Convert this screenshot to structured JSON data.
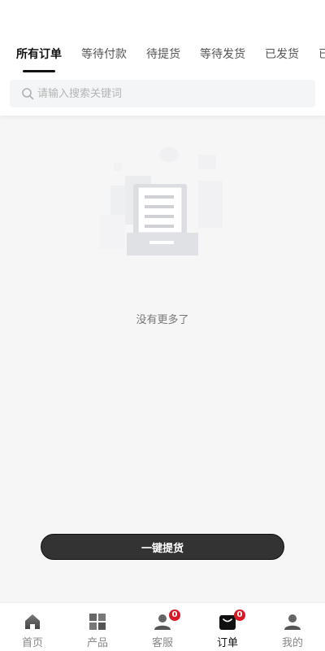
{
  "tabs": [
    {
      "label": "所有订单",
      "active": true
    },
    {
      "label": "等待付款",
      "active": false
    },
    {
      "label": "待提货",
      "active": false
    },
    {
      "label": "等待发货",
      "active": false
    },
    {
      "label": "已发货",
      "active": false
    },
    {
      "label": "已",
      "active": false
    }
  ],
  "search": {
    "placeholder": "请输入搜索关键词",
    "value": ""
  },
  "empty_state": {
    "text": "没有更多了"
  },
  "action_button": {
    "label": "一键提货"
  },
  "bottom_nav": [
    {
      "label": "首页",
      "icon": "home-icon",
      "badge": null
    },
    {
      "label": "产品",
      "icon": "grid-icon",
      "badge": null
    },
    {
      "label": "客服",
      "icon": "customer-service-icon",
      "badge": "0"
    },
    {
      "label": "订单",
      "icon": "order-bag-icon",
      "badge": "0",
      "active": true
    },
    {
      "label": "我的",
      "icon": "user-icon",
      "badge": null
    }
  ],
  "colors": {
    "accent": "#111111",
    "badge": "#d71a2a",
    "button": "#333333"
  }
}
